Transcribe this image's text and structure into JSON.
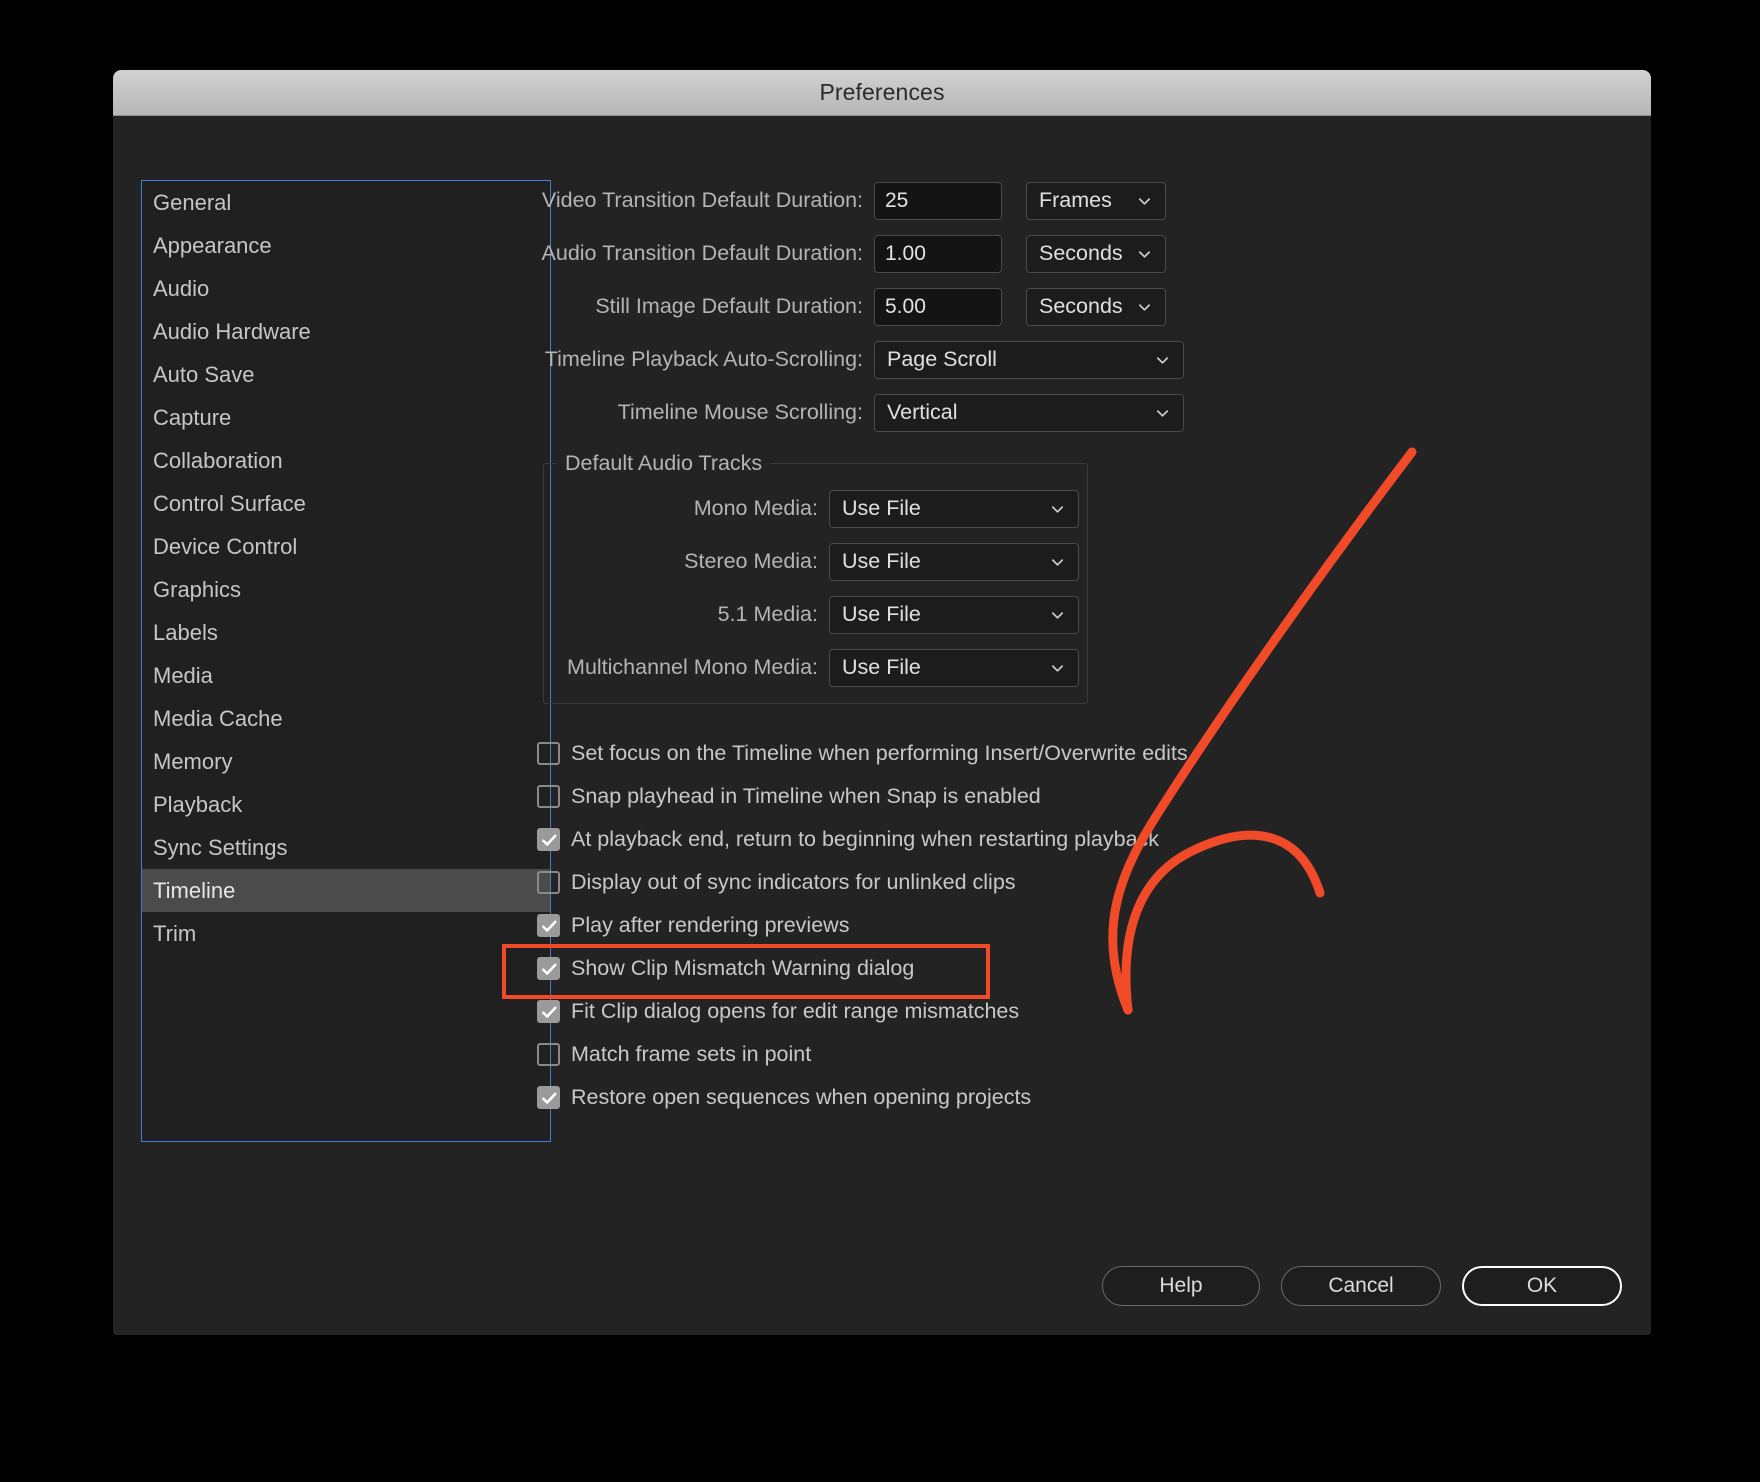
{
  "window": {
    "title": "Preferences"
  },
  "sidebar": {
    "items": [
      {
        "label": "General",
        "selected": false
      },
      {
        "label": "Appearance",
        "selected": false
      },
      {
        "label": "Audio",
        "selected": false
      },
      {
        "label": "Audio Hardware",
        "selected": false
      },
      {
        "label": "Auto Save",
        "selected": false
      },
      {
        "label": "Capture",
        "selected": false
      },
      {
        "label": "Collaboration",
        "selected": false
      },
      {
        "label": "Control Surface",
        "selected": false
      },
      {
        "label": "Device Control",
        "selected": false
      },
      {
        "label": "Graphics",
        "selected": false
      },
      {
        "label": "Labels",
        "selected": false
      },
      {
        "label": "Media",
        "selected": false
      },
      {
        "label": "Media Cache",
        "selected": false
      },
      {
        "label": "Memory",
        "selected": false
      },
      {
        "label": "Playback",
        "selected": false
      },
      {
        "label": "Sync Settings",
        "selected": false
      },
      {
        "label": "Timeline",
        "selected": true
      },
      {
        "label": "Trim",
        "selected": false
      }
    ]
  },
  "main": {
    "fields": [
      {
        "label": "Video Transition Default Duration:",
        "value": "25",
        "unit": "Frames"
      },
      {
        "label": "Audio Transition Default Duration:",
        "value": "1.00",
        "unit": "Seconds"
      },
      {
        "label": "Still Image Default Duration:",
        "value": "5.00",
        "unit": "Seconds"
      }
    ],
    "selects": [
      {
        "label": "Timeline Playback Auto-Scrolling:",
        "value": "Page Scroll"
      },
      {
        "label": "Timeline Mouse Scrolling:",
        "value": "Vertical"
      }
    ],
    "audio_group": {
      "title": "Default Audio Tracks",
      "rows": [
        {
          "label": "Mono Media:",
          "value": "Use File"
        },
        {
          "label": "Stereo Media:",
          "value": "Use File"
        },
        {
          "label": "5.1 Media:",
          "value": "Use File"
        },
        {
          "label": "Multichannel Mono Media:",
          "value": "Use File"
        }
      ]
    },
    "checkboxes": [
      {
        "label": "Set focus on the Timeline when performing Insert/Overwrite edits",
        "checked": false,
        "highlighted": false
      },
      {
        "label": "Snap playhead in Timeline when Snap is enabled",
        "checked": false,
        "highlighted": false
      },
      {
        "label": "At playback end, return to beginning when restarting playback",
        "checked": true,
        "highlighted": false
      },
      {
        "label": "Display out of sync indicators for unlinked clips",
        "checked": false,
        "highlighted": false
      },
      {
        "label": "Play after rendering previews",
        "checked": true,
        "highlighted": false
      },
      {
        "label": "Show Clip Mismatch Warning dialog",
        "checked": true,
        "highlighted": false
      },
      {
        "label": "Fit Clip dialog opens for edit range mismatches",
        "checked": true,
        "highlighted": true
      },
      {
        "label": "Match frame sets in point",
        "checked": false,
        "highlighted": false
      },
      {
        "label": "Restore open sequences when opening projects",
        "checked": true,
        "highlighted": false
      }
    ]
  },
  "footer": {
    "help_label": "Help",
    "cancel_label": "Cancel",
    "ok_label": "OK"
  },
  "annotation": {
    "highlight_color": "#f04a28",
    "arrow_color": "#f04a28",
    "target_label": "Fit Clip dialog opens for edit range mismatches"
  },
  "colors": {
    "focus_border": "#3c7fd4",
    "selection": "#4b4b4b",
    "dialog_bg": "#232323",
    "titlebar": "#c2c2c2"
  }
}
